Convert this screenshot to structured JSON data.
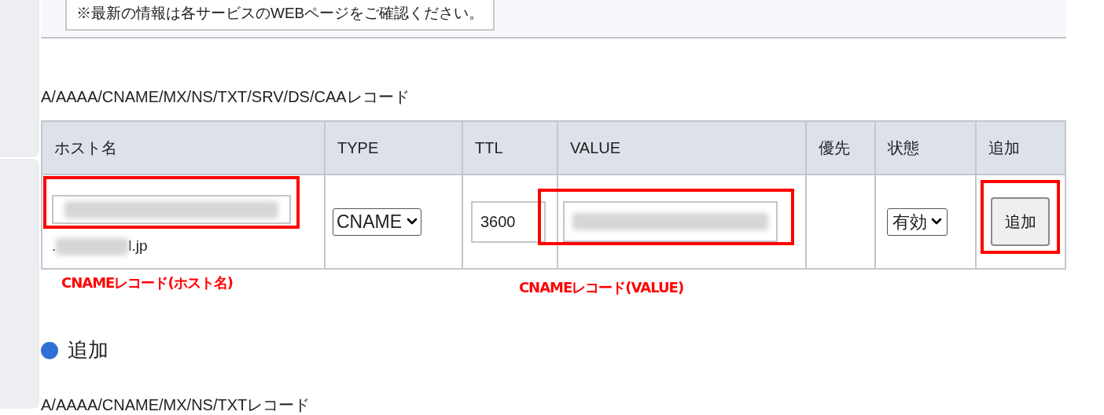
{
  "notice": "※最新の情報は各サービスのWEBページをご確認ください。",
  "records_heading": "A/AAAA/CNAME/MX/NS/TXT/SRV/DS/CAAレコード",
  "table": {
    "columns": [
      "ホスト名",
      "TYPE",
      "TTL",
      "VALUE",
      "優先",
      "状態",
      "追加"
    ],
    "row": {
      "host_suffix_start": ".",
      "host_suffix_end": "l.jp",
      "type": "CNAME",
      "ttl": "3600",
      "status": "有効",
      "add_button": "追加"
    }
  },
  "annotations": [
    {
      "text": "CNAMEレコード(ホスト名)",
      "color": "#ff0000"
    },
    {
      "text": "CNAMEレコード(VALUE)",
      "color": "#ff0000"
    }
  ],
  "section": {
    "title": "追加",
    "color": "#2f6fd6"
  },
  "next_heading": "A/AAAA/CNAME/MX/NS/TXTレコード"
}
